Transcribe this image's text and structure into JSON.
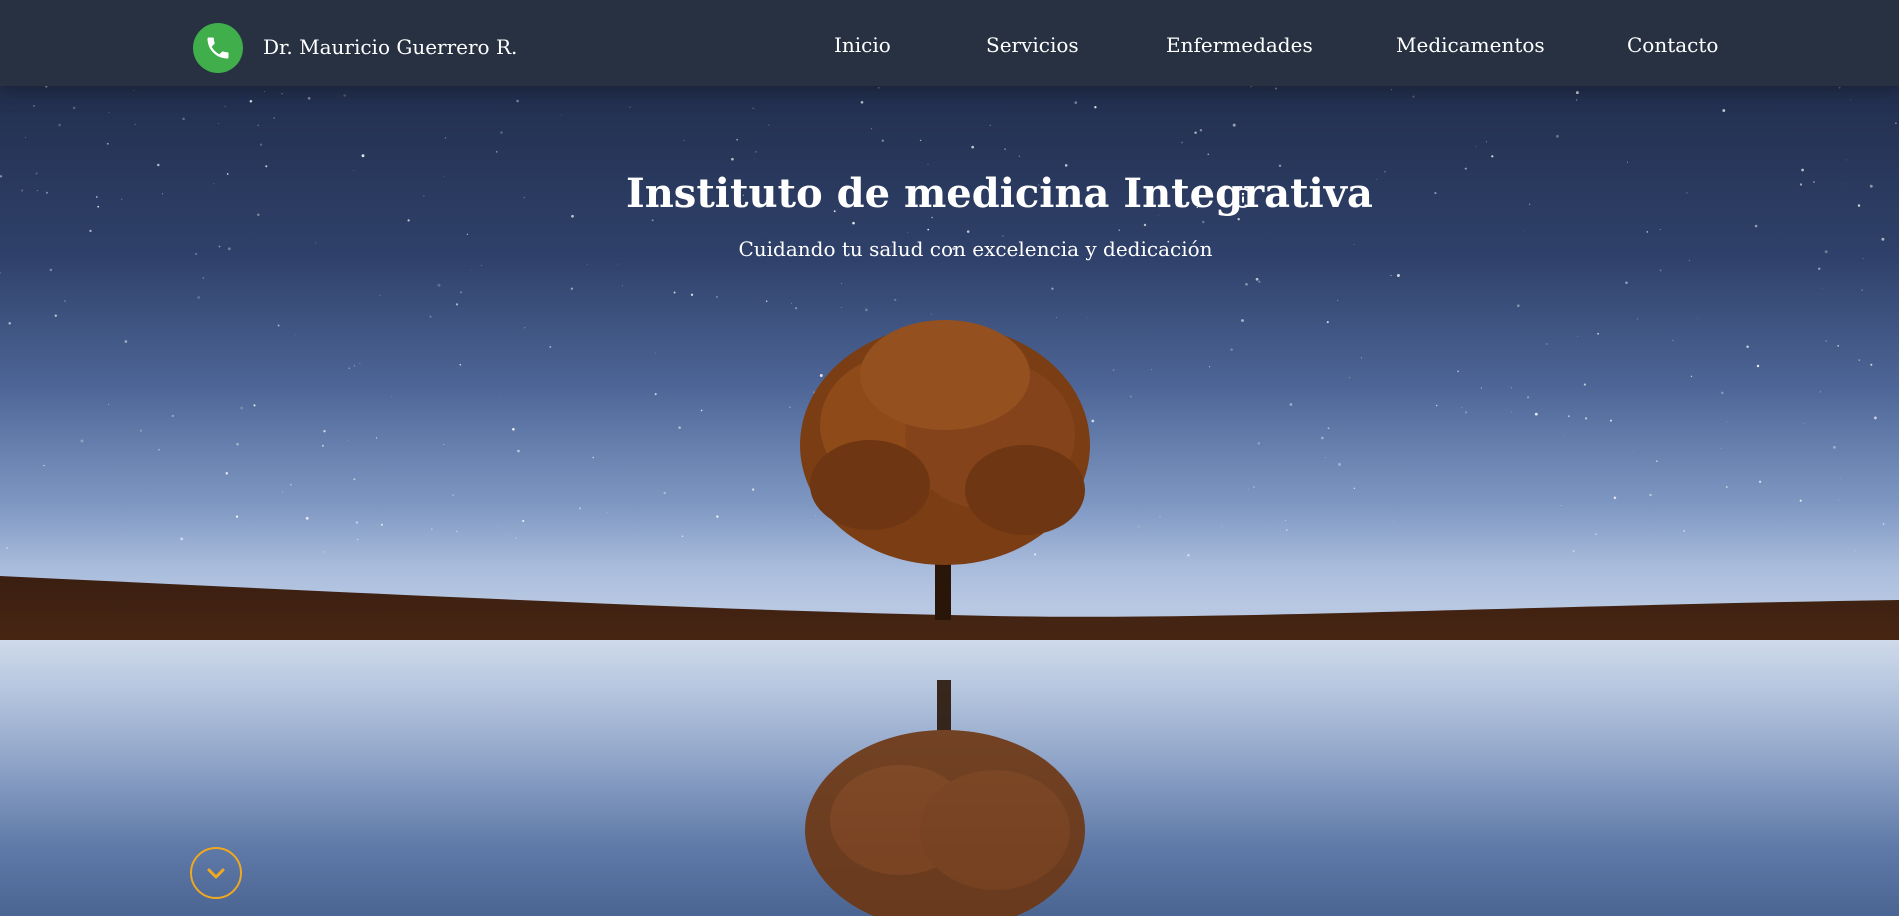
{
  "header": {
    "brand_name": "Dr. Mauricio Guerrero R.",
    "phone_icon": "phone-icon",
    "nav": [
      {
        "label": "Inicio"
      },
      {
        "label": "Servicios"
      },
      {
        "label": "Enfermedades"
      },
      {
        "label": "Medicamentos"
      },
      {
        "label": "Contacto"
      }
    ]
  },
  "hero": {
    "title": "Instituto de medicina Integrativa",
    "subtitle": "Cuidando tu salud con excelencia y dedicación",
    "info_icon": "info-icon",
    "scroll_icon": "chevron-down-icon",
    "background": "night sky with lone tree reflected in water"
  },
  "colors": {
    "navbar": "#273142",
    "phone_button": "#3fae4b",
    "scroll_accent": "#f0a81e",
    "text": "#ffffff"
  }
}
